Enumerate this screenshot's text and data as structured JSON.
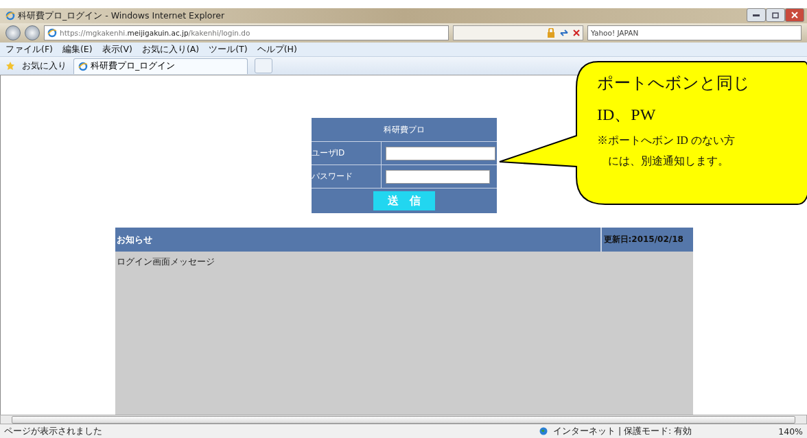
{
  "window": {
    "title": "科研費プロ_ログイン - Windows Internet Explorer"
  },
  "address_bar": {
    "url": "https://mgkakenhi.**meijigakuin.ac.jp**/kakenhi/login.do"
  },
  "search_box": {
    "value": "Yahoo! JAPAN"
  },
  "menu": [
    "ファイル(F)",
    "編集(E)",
    "表示(V)",
    "お気に入り(A)",
    "ツール(T)",
    "ヘルプ(H)"
  ],
  "favorites": {
    "label": "お気に入り"
  },
  "tabs": [
    {
      "label": "科研費プロ_ログイン",
      "selected": true
    }
  ],
  "login": {
    "title": "科研費プロ",
    "fields": [
      {
        "label": "ユーザID"
      },
      {
        "label": "パスワード"
      }
    ],
    "submit": "送　信"
  },
  "notice": {
    "title": "お知らせ",
    "updated": "更新日:2015/02/18",
    "message": "ログイン画面メッセージ"
  },
  "callout": {
    "lines": [
      "ポートへボンと同じ",
      "ID、PW"
    ],
    "note": [
      "※ポートへボン ID のない方",
      "には、別途通知します。"
    ]
  },
  "status_bar": {
    "text": "ページが表示されました",
    "zone": "インターネット | 保護モード: 有効",
    "zoom": "140%"
  }
}
